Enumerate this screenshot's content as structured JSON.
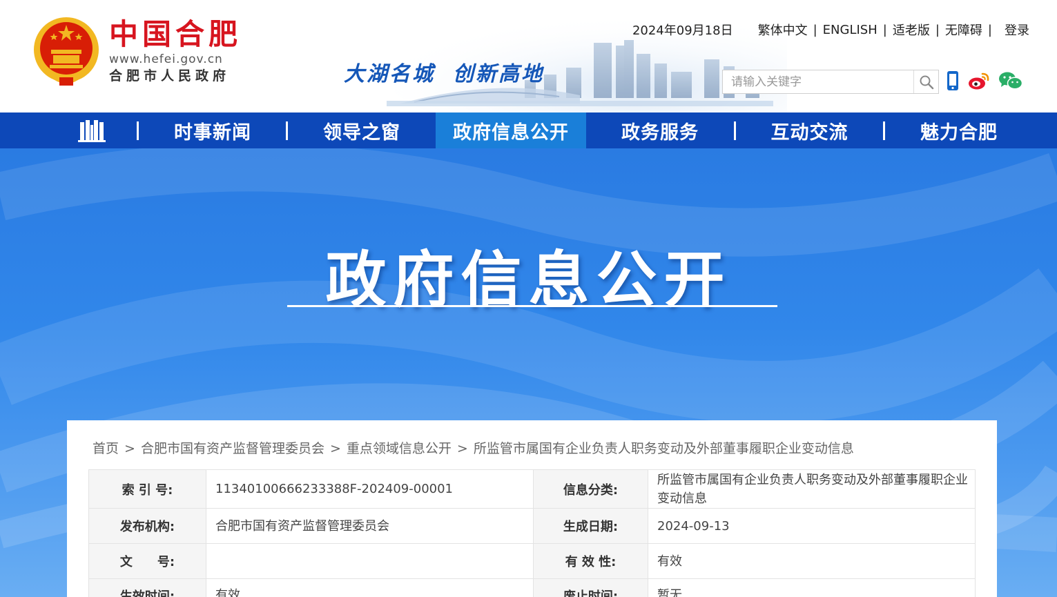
{
  "header": {
    "logo_title": "中国合肥",
    "logo_domain": "www.hefei.gov.cn",
    "logo_subtitle": "合肥市人民政府",
    "slogan_1": "大湖名城",
    "slogan_2": "创新高地",
    "date": "2024年09月18日",
    "links": [
      "繁体中文",
      "ENGLISH",
      "适老版",
      "无障碍",
      "登录"
    ],
    "search_placeholder": "请输入关键字",
    "icons": [
      "search-icon",
      "mobile-icon",
      "weibo-icon",
      "wechat-icon"
    ]
  },
  "nav": {
    "items": [
      "时事新闻",
      "领导之窗",
      "政府信息公开",
      "政务服务",
      "互动交流",
      "魅力合肥"
    ],
    "active_index": 2
  },
  "banner": {
    "title": "政府信息公开"
  },
  "breadcrumb": [
    "首页",
    "合肥市国有资产监督管理委员会",
    "重点领域信息公开",
    "所监管市属国有企业负责人职务变动及外部董事履职企业变动信息"
  ],
  "meta_table": {
    "rows": [
      {
        "k1": "索 引 号:",
        "v1": "11340100666233388F-202409-00001",
        "k2": "信息分类:",
        "v2": "所监管市属国有企业负责人职务变动及外部董事履职企业变动信息"
      },
      {
        "k1": "发布机构:",
        "v1": "合肥市国有资产监督管理委员会",
        "k2": "生成日期:",
        "v2": "2024-09-13"
      },
      {
        "k1": "文　　号:",
        "v1": "",
        "k2": "有 效 性:",
        "v2": "有效"
      },
      {
        "k1": "生效时间:",
        "v1": "有效",
        "k2": "废止时间:",
        "v2": "暂无"
      }
    ]
  },
  "colors": {
    "nav_bg": "#0d48b8",
    "nav_active": "#1a7fd9",
    "logo_red": "#d7151f",
    "banner_blue": "#2f7fe6"
  }
}
